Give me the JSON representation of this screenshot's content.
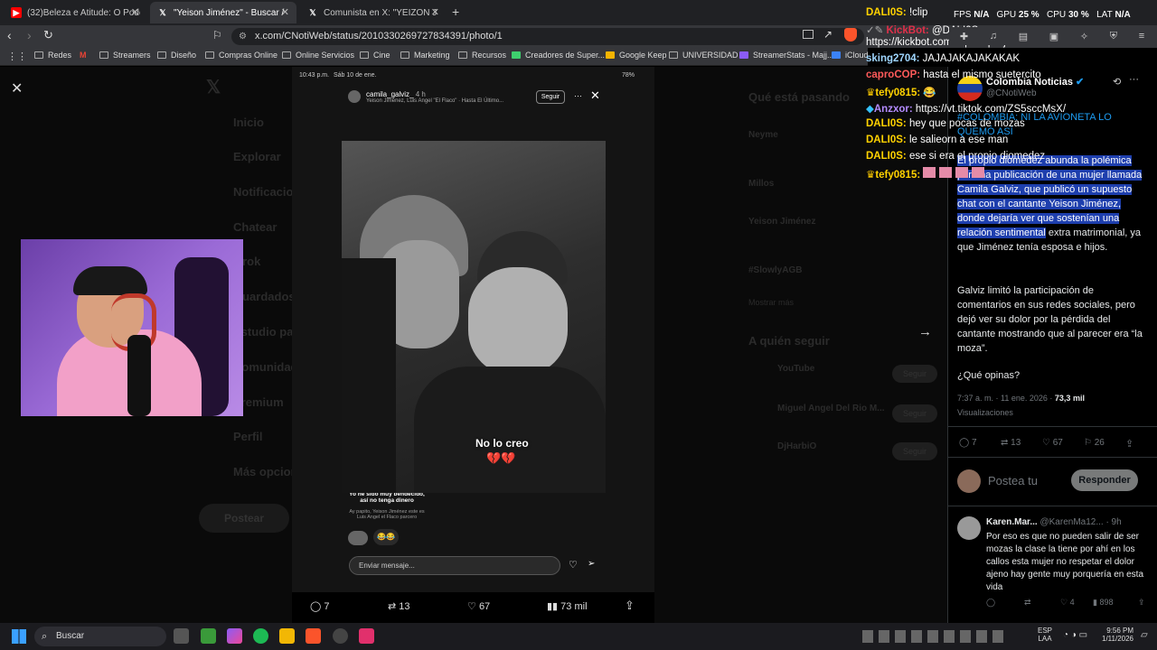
{
  "browser": {
    "tabs": [
      {
        "label": "(32)Beleza e Atitude: O Poder da Sín",
        "icon": "youtube-icon"
      },
      {
        "label": "\"Yeison Jiménez\" - Buscar / X",
        "icon": "x-icon"
      },
      {
        "label": "Comunista en X: \"YEIZON JIMENEZ V",
        "icon": "x-icon"
      }
    ],
    "url": "x.com/CNotiWeb/status/2010330269727834391/photo/1",
    "bookmarks": [
      "Redes",
      "Streamers",
      "Diseño",
      "Compras Online",
      "Online Servicios",
      "Cine",
      "Marketing",
      "Recursos",
      "Creadores de Super...",
      "Google Keep",
      "UNIVERSIDAD",
      "StreamerStats - Majj...",
      "iCloud"
    ]
  },
  "background_nav": [
    "Inicio",
    "Explorar",
    "Notificaciones",
    "Chatear",
    "Grok",
    "Guardados",
    "Estudio pa",
    "Comunidades",
    "Premium",
    "Perfil",
    "Más opciones"
  ],
  "background_side": {
    "whats_happening": "Qué está pasando",
    "who_to_follow": "A quién seguir",
    "items": [
      "Neyme",
      "Millos",
      "Yeison Jiménez",
      "#SlowlyAGB",
      "YouTube",
      "Miguel Angel Del Rio M...",
      "DjHarbiO"
    ],
    "follow": "Seguir",
    "show_more": "Mostrar más",
    "post_button": "Postear"
  },
  "story": {
    "status_time": "10:43 p.m.",
    "status_date": "Sáb 10 de ene.",
    "battery": "78%",
    "username": "camila_galviz_",
    "age": "4 h",
    "subtitle": "Yeison Jimenez, Luis Angel \"El Flaco\" · Hasta El Último...",
    "follow": "Seguir",
    "sticker_text": "No lo creo",
    "sticker_emoji": "💔💔",
    "caption": "Yo he sido muy bendecido, así no tenga dinero",
    "comment": "Ay papito, Yeison Jiménez este es Luis Angel el Flaco parcero",
    "reaction": "😂😂",
    "reply_placeholder": "Enviar mensaje..."
  },
  "photo_actions": {
    "replies": "7",
    "reposts": "13",
    "likes": "67",
    "views": "73 mil"
  },
  "post": {
    "author": "Colombia Noticias",
    "handle": "@CNotiWeb",
    "headline": "#COLOMBIA: NI LA AVIONETA LO QUEMÓ ASÍ",
    "body_selected": "El propio diomedez abunda la polémica por una publicación de una mujer llamada Camila Galviz, que publicó un supuesto chat con el cantante Yeison Jiménez, donde dejaría ver que sostenían una relación sentimental",
    "body_rest": " extra matrimonial, ya que Jiménez tenía esposa e hijos.",
    "para2": "Galviz limitó la participación de comentarios en sus redes sociales, pero dejó ver su dolor por la pérdida del cantante mostrando que al parecer era “la moza”.",
    "para3": "¿Qué opinas?",
    "timestamp": "7:37 a. m. · 11 ene. 2026 ·",
    "views_count": "73,3 mil",
    "views_label": "Visualizaciones",
    "replies": "7",
    "reposts": "13",
    "likes": "67",
    "bookmarks": "26",
    "reply_placeholder": "Postea tu",
    "reply_button": "Responder"
  },
  "reply": {
    "author": "Karen.Mar...",
    "handle": "@KarenMa12...",
    "age": "· 9h",
    "text": "Por eso es que no pueden salir de ser mozas la clase la tiene por ahí en los callos esta mujer no respetar el dolor ajeno hay gente muy porquería en esta vida",
    "likes": "4",
    "views": "898"
  },
  "chat": [
    {
      "user": "DALI0S:",
      "msg": "!clip",
      "color": "#ffd200"
    },
    {
      "user": "KickBot:",
      "msg": "@DALI0S",
      "color": "#e0304a"
    },
    {
      "user": "",
      "msg": "https://kickbot.com/clip/v8qstltj0e0n",
      "color": "#fff"
    },
    {
      "user": "sking2704:",
      "msg": "JAJAJAKAJAKAKAK",
      "color": "#9fd6ff"
    },
    {
      "user": "caproCOP:",
      "msg": "hasta el mismo suetercito",
      "color": "#ff5a5a"
    },
    {
      "user": "tefy0815:",
      "msg": "😂",
      "color": "#ffd200"
    },
    {
      "user": "Anzxor:",
      "msg": "https://vt.tiktok.com/ZS5sccMsX/",
      "color": "#b48cff"
    },
    {
      "user": "DALI0S:",
      "msg": "hey que pocas de mozas",
      "color": "#ffd200"
    },
    {
      "user": "DALI0S:",
      "msg": "le salieorn a ese man",
      "color": "#ffd200"
    },
    {
      "user": "DALI0S:",
      "msg": "ese si era el propio diomedez",
      "color": "#ffd200"
    },
    {
      "user": "tefy0815:",
      "msg": "",
      "color": "#ffd200"
    }
  ],
  "stats": {
    "fps_label": "FPS",
    "fps": "N/A",
    "gpu_label": "GPU",
    "gpu": "25 %",
    "cpu_label": "CPU",
    "cpu": "30 %",
    "lat_label": "LAT",
    "lat": "N/A"
  },
  "taskbar": {
    "search": "Buscar",
    "lang": "ESP",
    "lang2": "LAA",
    "time": "9:56 PM",
    "date": "1/11/2026"
  }
}
